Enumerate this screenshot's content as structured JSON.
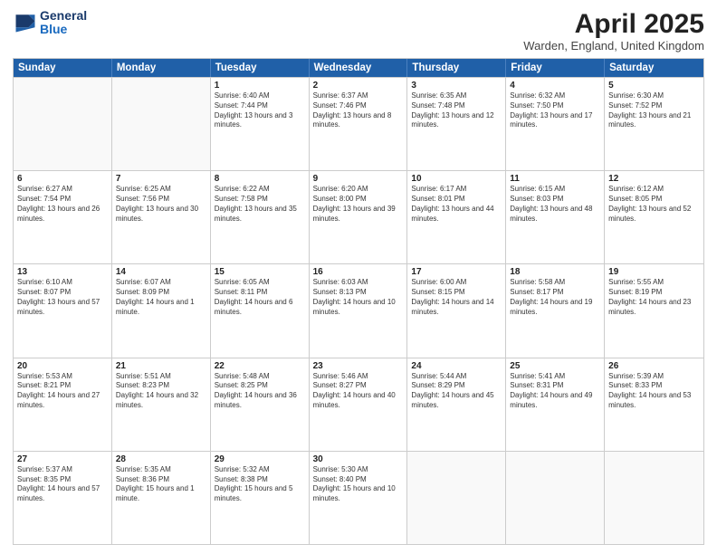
{
  "header": {
    "logo_line1": "General",
    "logo_line2": "Blue",
    "month_title": "April 2025",
    "location": "Warden, England, United Kingdom"
  },
  "days_of_week": [
    "Sunday",
    "Monday",
    "Tuesday",
    "Wednesday",
    "Thursday",
    "Friday",
    "Saturday"
  ],
  "weeks": [
    [
      {
        "day": "",
        "info": ""
      },
      {
        "day": "",
        "info": ""
      },
      {
        "day": "1",
        "info": "Sunrise: 6:40 AM\nSunset: 7:44 PM\nDaylight: 13 hours and 3 minutes."
      },
      {
        "day": "2",
        "info": "Sunrise: 6:37 AM\nSunset: 7:46 PM\nDaylight: 13 hours and 8 minutes."
      },
      {
        "day": "3",
        "info": "Sunrise: 6:35 AM\nSunset: 7:48 PM\nDaylight: 13 hours and 12 minutes."
      },
      {
        "day": "4",
        "info": "Sunrise: 6:32 AM\nSunset: 7:50 PM\nDaylight: 13 hours and 17 minutes."
      },
      {
        "day": "5",
        "info": "Sunrise: 6:30 AM\nSunset: 7:52 PM\nDaylight: 13 hours and 21 minutes."
      }
    ],
    [
      {
        "day": "6",
        "info": "Sunrise: 6:27 AM\nSunset: 7:54 PM\nDaylight: 13 hours and 26 minutes."
      },
      {
        "day": "7",
        "info": "Sunrise: 6:25 AM\nSunset: 7:56 PM\nDaylight: 13 hours and 30 minutes."
      },
      {
        "day": "8",
        "info": "Sunrise: 6:22 AM\nSunset: 7:58 PM\nDaylight: 13 hours and 35 minutes."
      },
      {
        "day": "9",
        "info": "Sunrise: 6:20 AM\nSunset: 8:00 PM\nDaylight: 13 hours and 39 minutes."
      },
      {
        "day": "10",
        "info": "Sunrise: 6:17 AM\nSunset: 8:01 PM\nDaylight: 13 hours and 44 minutes."
      },
      {
        "day": "11",
        "info": "Sunrise: 6:15 AM\nSunset: 8:03 PM\nDaylight: 13 hours and 48 minutes."
      },
      {
        "day": "12",
        "info": "Sunrise: 6:12 AM\nSunset: 8:05 PM\nDaylight: 13 hours and 52 minutes."
      }
    ],
    [
      {
        "day": "13",
        "info": "Sunrise: 6:10 AM\nSunset: 8:07 PM\nDaylight: 13 hours and 57 minutes."
      },
      {
        "day": "14",
        "info": "Sunrise: 6:07 AM\nSunset: 8:09 PM\nDaylight: 14 hours and 1 minute."
      },
      {
        "day": "15",
        "info": "Sunrise: 6:05 AM\nSunset: 8:11 PM\nDaylight: 14 hours and 6 minutes."
      },
      {
        "day": "16",
        "info": "Sunrise: 6:03 AM\nSunset: 8:13 PM\nDaylight: 14 hours and 10 minutes."
      },
      {
        "day": "17",
        "info": "Sunrise: 6:00 AM\nSunset: 8:15 PM\nDaylight: 14 hours and 14 minutes."
      },
      {
        "day": "18",
        "info": "Sunrise: 5:58 AM\nSunset: 8:17 PM\nDaylight: 14 hours and 19 minutes."
      },
      {
        "day": "19",
        "info": "Sunrise: 5:55 AM\nSunset: 8:19 PM\nDaylight: 14 hours and 23 minutes."
      }
    ],
    [
      {
        "day": "20",
        "info": "Sunrise: 5:53 AM\nSunset: 8:21 PM\nDaylight: 14 hours and 27 minutes."
      },
      {
        "day": "21",
        "info": "Sunrise: 5:51 AM\nSunset: 8:23 PM\nDaylight: 14 hours and 32 minutes."
      },
      {
        "day": "22",
        "info": "Sunrise: 5:48 AM\nSunset: 8:25 PM\nDaylight: 14 hours and 36 minutes."
      },
      {
        "day": "23",
        "info": "Sunrise: 5:46 AM\nSunset: 8:27 PM\nDaylight: 14 hours and 40 minutes."
      },
      {
        "day": "24",
        "info": "Sunrise: 5:44 AM\nSunset: 8:29 PM\nDaylight: 14 hours and 45 minutes."
      },
      {
        "day": "25",
        "info": "Sunrise: 5:41 AM\nSunset: 8:31 PM\nDaylight: 14 hours and 49 minutes."
      },
      {
        "day": "26",
        "info": "Sunrise: 5:39 AM\nSunset: 8:33 PM\nDaylight: 14 hours and 53 minutes."
      }
    ],
    [
      {
        "day": "27",
        "info": "Sunrise: 5:37 AM\nSunset: 8:35 PM\nDaylight: 14 hours and 57 minutes."
      },
      {
        "day": "28",
        "info": "Sunrise: 5:35 AM\nSunset: 8:36 PM\nDaylight: 15 hours and 1 minute."
      },
      {
        "day": "29",
        "info": "Sunrise: 5:32 AM\nSunset: 8:38 PM\nDaylight: 15 hours and 5 minutes."
      },
      {
        "day": "30",
        "info": "Sunrise: 5:30 AM\nSunset: 8:40 PM\nDaylight: 15 hours and 10 minutes."
      },
      {
        "day": "",
        "info": ""
      },
      {
        "day": "",
        "info": ""
      },
      {
        "day": "",
        "info": ""
      }
    ]
  ]
}
